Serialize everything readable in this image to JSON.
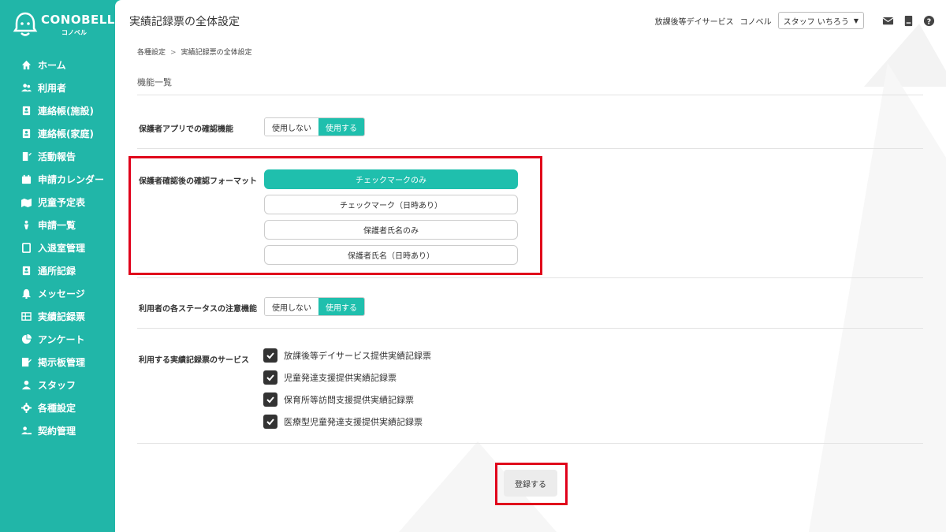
{
  "brand": {
    "name": "CONOBELL",
    "sub": "コノベル"
  },
  "sidebar": {
    "items": [
      {
        "label": "ホーム",
        "icon": "home-icon"
      },
      {
        "label": "利用者",
        "icon": "users-icon"
      },
      {
        "label": "連絡帳(施設)",
        "icon": "contact-book-icon"
      },
      {
        "label": "連絡帳(家庭)",
        "icon": "contact-book-icon"
      },
      {
        "label": "活動報告",
        "icon": "report-icon"
      },
      {
        "label": "申請カレンダー",
        "icon": "calendar-icon"
      },
      {
        "label": "児童予定表",
        "icon": "schedule-icon"
      },
      {
        "label": "申請一覧",
        "icon": "list-icon"
      },
      {
        "label": "入退室管理",
        "icon": "door-icon"
      },
      {
        "label": "通所記録",
        "icon": "record-icon"
      },
      {
        "label": "メッセージ",
        "icon": "bell-icon"
      },
      {
        "label": "実績記録票",
        "icon": "table-icon"
      },
      {
        "label": "アンケート",
        "icon": "survey-icon"
      },
      {
        "label": "掲示板管理",
        "icon": "board-icon"
      },
      {
        "label": "スタッフ",
        "icon": "staff-icon"
      },
      {
        "label": "各種設定",
        "icon": "gear-icon"
      },
      {
        "label": "契約管理",
        "icon": "contract-icon"
      }
    ]
  },
  "header": {
    "title": "実績記録票の全体設定",
    "service": "放課後等デイサービス",
    "org": "コノベル",
    "staff": "スタッフ いちろう"
  },
  "breadcrumb": {
    "parent": "各種設定",
    "sep": ">",
    "current": "実績記録票の全体設定"
  },
  "section_title": "機能一覧",
  "rows": {
    "parent_app": {
      "label": "保護者アプリでの確認機能",
      "options": [
        "使用しない",
        "使用する"
      ],
      "selected": "使用する"
    },
    "confirm_format": {
      "label": "保護者確認後の確認フォーマット",
      "options": [
        "チェックマークのみ",
        "チェックマーク（日時あり）",
        "保護者氏名のみ",
        "保護者氏名（日時あり）"
      ],
      "selected": "チェックマークのみ"
    },
    "status_alert": {
      "label": "利用者の各ステータスの注意機能",
      "options": [
        "使用しない",
        "使用する"
      ],
      "selected": "使用する"
    },
    "services": {
      "label": "利用する実績記録票のサービス",
      "items": [
        "放課後等デイサービス提供実績記録票",
        "児童発達支援提供実績記録票",
        "保育所等訪問支援提供実績記録票",
        "医療型児童発達支援提供実績記録票"
      ]
    }
  },
  "submit_label": "登録する",
  "colors": {
    "accent": "#1fbfad",
    "sidebar": "#21b6a8",
    "highlight": "#e0001b"
  }
}
